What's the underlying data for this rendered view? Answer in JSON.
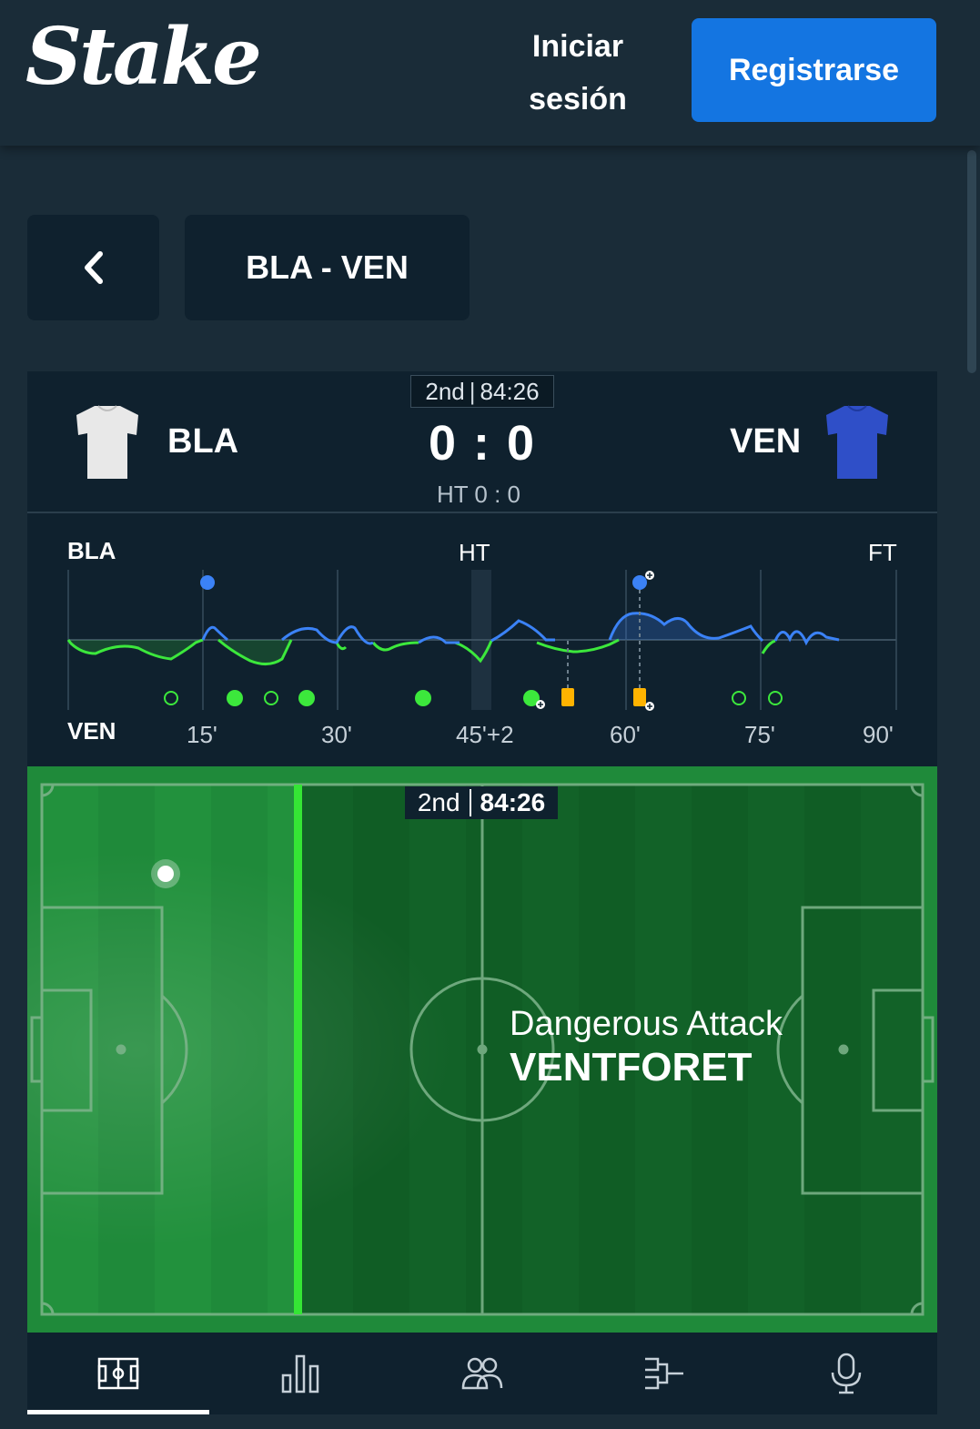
{
  "header": {
    "logo_text": "Stake",
    "login_label": "Iniciar sesión",
    "register_label": "Registrarse"
  },
  "nav": {
    "match_title": "BLA - VEN"
  },
  "scoreboard": {
    "period": "2nd",
    "clock": "84:26",
    "home_team": "BLA",
    "away_team": "VEN",
    "score": "0 : 0",
    "halftime": "HT 0 : 0",
    "home_shirt_color": "#e8e8e8",
    "away_shirt_color": "#2f4fc8"
  },
  "timeline": {
    "home_label": "BLA",
    "away_label": "VEN",
    "ht_label": "HT",
    "ft_label": "FT",
    "ticks": [
      "15'",
      "30'",
      "45'+2",
      "60'",
      "75'",
      "90'"
    ],
    "home_color": "#3b82f6",
    "away_color": "#3ce83c",
    "card_color": "#ffb300"
  },
  "pitch": {
    "period": "2nd",
    "clock": "84:26",
    "event_label": "Dangerous Attack",
    "event_team": "VENTFORET"
  },
  "tabs": [
    {
      "name": "pitch-icon"
    },
    {
      "name": "stats-icon"
    },
    {
      "name": "lineups-icon"
    },
    {
      "name": "bracket-icon"
    },
    {
      "name": "commentary-icon"
    }
  ]
}
